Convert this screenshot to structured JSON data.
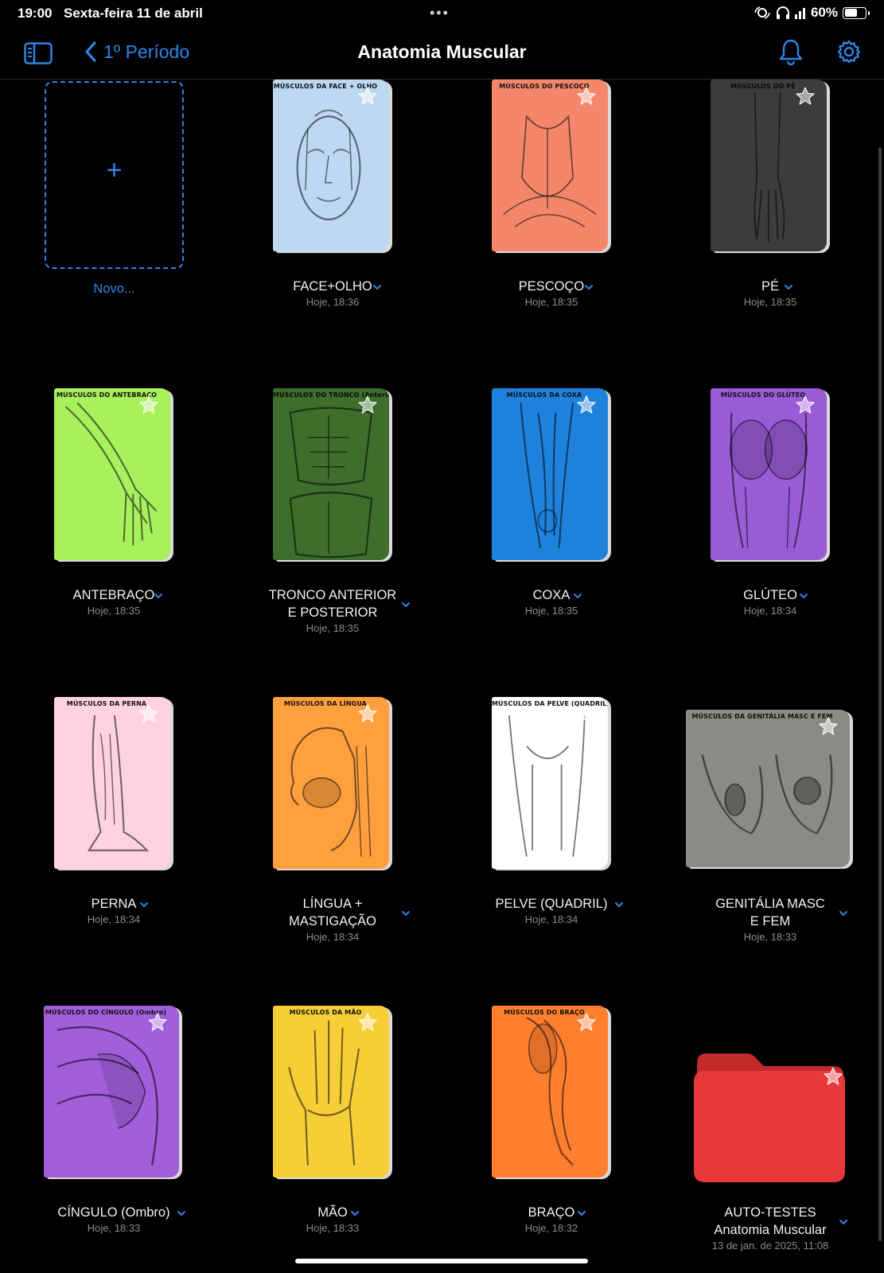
{
  "status_bar": {
    "time": "19:00",
    "date": "Sexta-feira 11 de abril",
    "battery": "60%",
    "battery_level": 0.6
  },
  "nav": {
    "back_label": "1º Período",
    "title": "Anatomia Muscular",
    "accent": "#2f84e6"
  },
  "new_item": {
    "plus": "+",
    "label": "Novo..."
  },
  "items": [
    {
      "name": "FACE+OLHO",
      "time": "Hoje, 18:36",
      "cover_title": "MÚSCULOS DA FACE + OLHO",
      "color": "#bcd8f2",
      "art": "face-icon"
    },
    {
      "name": "PESCOÇO",
      "time": "Hoje, 18:35",
      "cover_title": "MÚSCULOS DO PESCOÇO",
      "color": "#f4876a",
      "art": "neck-icon"
    },
    {
      "name": "PÉ",
      "time": "Hoje, 18:35",
      "cover_title": "MÚSCULOS DO PÉ",
      "color": "#3c3c3c",
      "art": "foot-icon"
    },
    {
      "name": "ANTEBRAÇO",
      "time": "Hoje, 18:35",
      "cover_title": "MÚSCULOS DO ANTEBRAÇO",
      "color": "#a8f05c",
      "art": "forearm-icon"
    },
    {
      "name": "TRONCO ANTERIOR",
      "name2": "E POSTERIOR",
      "time": "Hoje, 18:35",
      "cover_title": "MÚSCULOS DO TRONCO (Anterior e Posterior)",
      "color": "#3f6e2c",
      "art": "torso-icon"
    },
    {
      "name": "COXA",
      "time": "Hoje, 18:35",
      "cover_title": "MÚSCULOS DA COXA",
      "color": "#1e82dc",
      "art": "thigh-icon"
    },
    {
      "name": "GLÚTEO",
      "time": "Hoje, 18:34",
      "cover_title": "MÚSCULOS DO GLÚTEO",
      "color": "#9a5bd6",
      "art": "gluteus-icon"
    },
    {
      "name": "PERNA",
      "time": "Hoje, 18:34",
      "cover_title": "MÚSCULOS DA PERNA",
      "color": "#ffd1e2",
      "art": "leg-icon"
    },
    {
      "name": "LÍNGUA +",
      "name2": "MASTIGAÇÃO",
      "time": "Hoje, 18:34",
      "cover_title": "MÚSCULOS DA LÍNGUA",
      "color": "#ff9f3e",
      "art": "tongue-icon"
    },
    {
      "name": "PELVE (QUADRIL)",
      "time": "Hoje, 18:34",
      "cover_title": "MÚSCULOS DA PELVE (QUADRIL)",
      "color": "#ffffff",
      "art": "pelvis-icon"
    },
    {
      "name": "GENITÁLIA MASC",
      "name2": "E FEM",
      "time": "Hoje, 18:33",
      "cover_title": "MÚSCULOS DA GENITÁLIA MASC E FEM",
      "color": "#8a8a86",
      "art": "genitalia-icon"
    },
    {
      "name": "CÍNGULO (Ombro)",
      "time": "Hoje, 18:33",
      "cover_title": "MÚSCULOS DO CÍNGULO (Ombro)",
      "color": "#a25fdc",
      "art": "shoulder-icon"
    },
    {
      "name": "MÃO",
      "time": "Hoje, 18:33",
      "cover_title": "MÚSCULOS DA MÃO",
      "color": "#f6cf37",
      "art": "hand-icon"
    },
    {
      "name": "BRAÇO",
      "time": "Hoje, 18:32",
      "cover_title": "MÚSCULOS DO BRAÇO",
      "color": "#ff7f2f",
      "art": "arm-icon"
    },
    {
      "name": "AUTO-TESTES",
      "name2": "Anatomia Muscular",
      "time": "13 de jan. de 2025, 11:08",
      "color": "#e8393a",
      "art": "folder-icon"
    }
  ]
}
